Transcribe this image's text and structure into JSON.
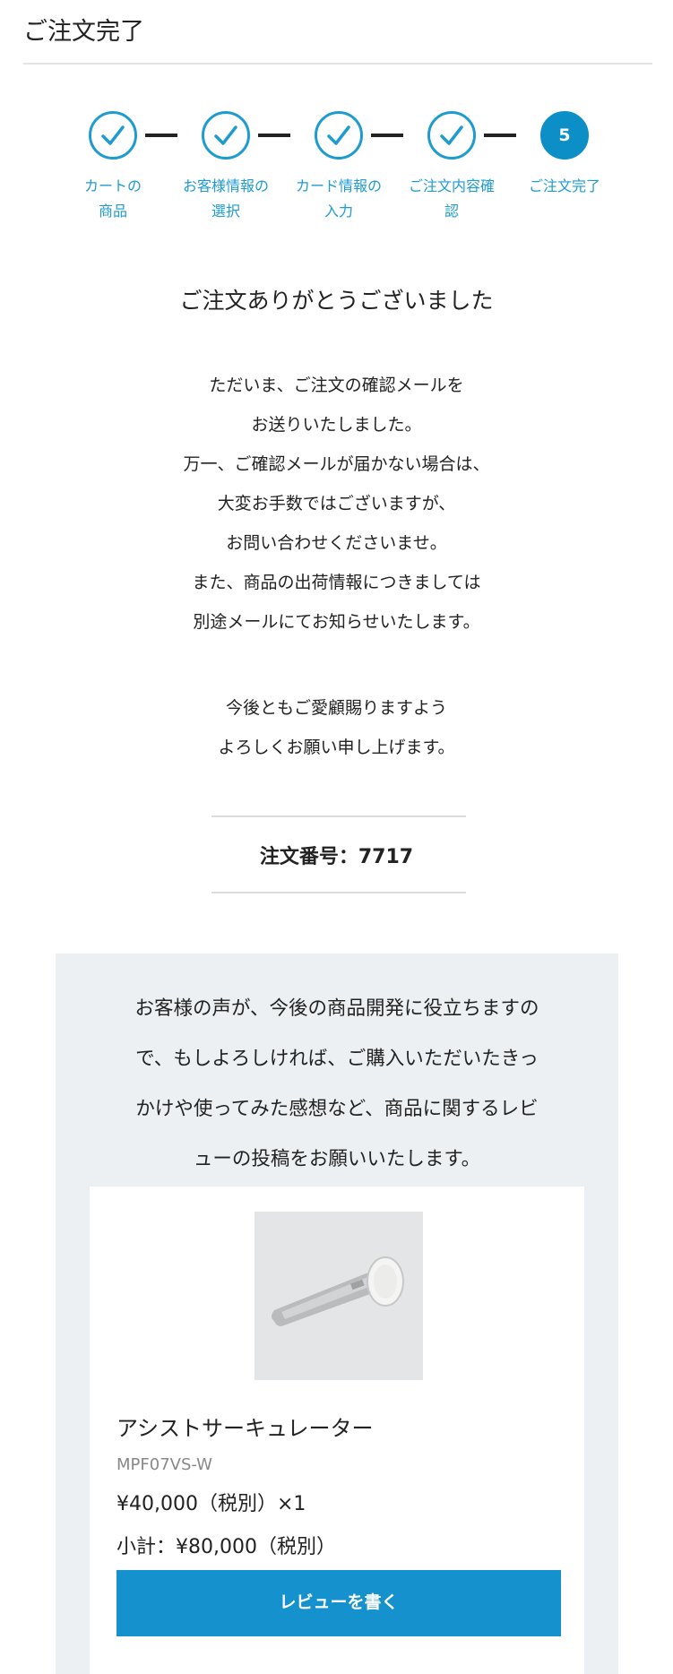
{
  "header": {
    "title": "ご注文完了"
  },
  "stepper": {
    "steps": [
      {
        "line1": "カートの",
        "line2": "商品",
        "status": "done"
      },
      {
        "line1": "お客様情報の",
        "line2": "選択",
        "status": "done"
      },
      {
        "line1": "カード情報の",
        "line2": "入力",
        "status": "done"
      },
      {
        "line1": "ご注文内容確",
        "line2": "認",
        "status": "done"
      },
      {
        "line1": "ご注文完了",
        "line2": "",
        "status": "current",
        "number": "5"
      }
    ],
    "accent_color": "#1e9bcf",
    "current_color": "#0b8fc6"
  },
  "thanks_title": "ご注文ありがとうございました",
  "message": {
    "lines": [
      "ただいま、ご注文の確認メールを",
      "お送りいたしました。",
      "万一、ご確認メールが届かない場合は、",
      "大変お手数ではございますが、",
      "お問い合わせくださいませ。",
      "また、商品の出荷情報につきましては",
      "別途メールにてお知らせいたします。"
    ],
    "closing": [
      "今後ともご愛顧賜りますよう",
      "よろしくお願い申し上げます。"
    ]
  },
  "order": {
    "number_text": "注文番号：7717"
  },
  "review": {
    "lines": [
      "お客様の声が、今後の商品開発に役立ちますの",
      "で、もしよろしければ、ご購入いただいたきっ",
      "かけや使ってみた感想など、商品に関するレビ",
      "ューの投稿をお願いいたします。"
    ],
    "panel_color": "#edf0f3"
  },
  "product": {
    "name": "アシストサーキュレーター",
    "sku": "MPF07VS-W",
    "price": "¥40,000（税別）×1",
    "subtotal": "小計：¥80,000（税別）",
    "image_icon": "circulator-product-image"
  },
  "review_button": {
    "label": "レビューを書く",
    "color": "#1592cd"
  }
}
